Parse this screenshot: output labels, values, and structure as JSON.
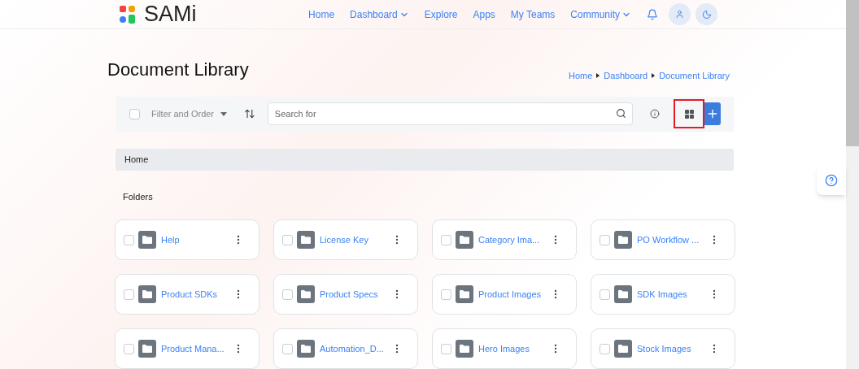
{
  "brand": "SAMi",
  "nav": [
    {
      "label": "Home",
      "dropdown": false
    },
    {
      "label": "Dashboard",
      "dropdown": true
    },
    {
      "label": "Explore",
      "dropdown": false
    },
    {
      "label": "Apps",
      "dropdown": false
    },
    {
      "label": "My Teams",
      "dropdown": false
    },
    {
      "label": "Community",
      "dropdown": true
    }
  ],
  "page_title": "Document Library",
  "breadcrumbs": [
    "Home",
    "Dashboard",
    "Document Library"
  ],
  "toolbar": {
    "select_all_checked": false,
    "filter_label": "Filter and Order",
    "search": {
      "placeholder": "Search for"
    },
    "grid_view_highlighted": true
  },
  "path_bar": "Home",
  "section_label": "Folders",
  "folders": [
    {
      "name": "Help",
      "checked": false
    },
    {
      "name": "License Key",
      "checked": false
    },
    {
      "name": "Category Ima...",
      "checked": false
    },
    {
      "name": "PO Workflow ...",
      "checked": false
    },
    {
      "name": "Product SDKs",
      "checked": false
    },
    {
      "name": "Product Specs",
      "checked": false
    },
    {
      "name": "Product Images",
      "checked": false
    },
    {
      "name": "SDK Images",
      "checked": false
    },
    {
      "name": "Product Mana...",
      "checked": false
    },
    {
      "name": "Automation_D...",
      "checked": false
    },
    {
      "name": "Hero Images",
      "checked": false
    },
    {
      "name": "Stock Images",
      "checked": false
    }
  ]
}
